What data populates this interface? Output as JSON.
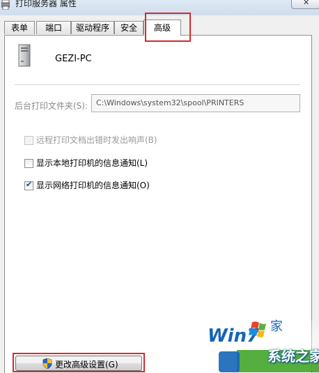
{
  "window": {
    "title": "打印服务器 属性",
    "title_icon": "printer-icon",
    "close_icon": "close-icon",
    "close_glyph": "✕"
  },
  "tabs": [
    {
      "label": "表单",
      "active": false
    },
    {
      "label": "端口",
      "active": false
    },
    {
      "label": "驱动程序",
      "active": false
    },
    {
      "label": "安全",
      "active": false
    },
    {
      "label": "高级",
      "active": true
    }
  ],
  "server": {
    "icon": "computer-tower-icon",
    "name": "GEZI-PC"
  },
  "spool_folder": {
    "label": "后台打印文件夹(S):",
    "value": "C:\\Windows\\system32\\spool\\PRINTERS",
    "disabled": true
  },
  "checkboxes": [
    {
      "label": "远程打印文档出错时发出响声(B)",
      "checked": false,
      "disabled": true
    },
    {
      "label": "显示本地打印机的信息通知(L)",
      "checked": false,
      "disabled": false
    },
    {
      "label": "显示网络打印机的信息通知(O)",
      "checked": true,
      "disabled": false
    }
  ],
  "checkmark_glyph": "✔",
  "advanced_button": {
    "label": "更改高级设置(G)",
    "icon": "uac-shield-icon"
  },
  "watermark": {
    "logo_icon": "win7-logo-icon",
    "text": "系统之家"
  },
  "colors": {
    "highlight_box": "#d42a2a",
    "checkmark": "#1d3f8a",
    "disabled_text": "#9a9a9a"
  }
}
